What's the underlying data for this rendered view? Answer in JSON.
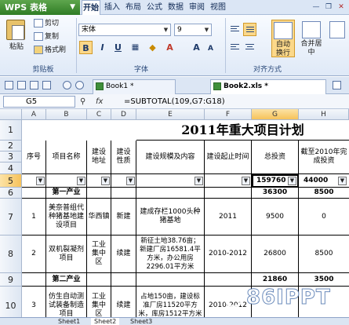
{
  "menubar": {
    "app_title": "WPS 表格",
    "items": [
      "开始",
      "插入",
      "布局",
      "公式",
      "数据",
      "审阅",
      "视图"
    ]
  },
  "ribbon": {
    "paste": "粘贴",
    "cut": "剪切",
    "copy": "复制",
    "format_painter": "格式刷",
    "clipboard_group": "剪贴板",
    "font_name": "宋体",
    "font_size": "9",
    "font_group": "字体",
    "align_group": "对齐方式",
    "wrap_text": "自动\n换行",
    "merge_center": "合并居\n中",
    "bold": "B",
    "italic": "I",
    "underline": "U"
  },
  "tabs": {
    "book1": "Book1 *",
    "book2": "Book2.xls *"
  },
  "formula_bar": {
    "cell_ref": "G5",
    "fx": "fx",
    "formula": "=SUBTOTAL(109,G7:G18)"
  },
  "columns": [
    "A",
    "B",
    "C",
    "D",
    "E",
    "F",
    "G",
    "H"
  ],
  "rows": [
    "1",
    "2",
    "3",
    "4",
    "5",
    "6",
    "7",
    "8",
    "9",
    "10"
  ],
  "sheet": {
    "title": "2011年重大项目计划",
    "headers": {
      "a": "序号",
      "b": "项目名称",
      "c": "建设\n地址",
      "d": "建设\n性质",
      "e": "建设规模及内容",
      "f": "建设起止时间",
      "g": "总投资",
      "h": "截至2010年完成投资"
    },
    "row5": {
      "g": "159760",
      "h": "44000"
    },
    "row6": {
      "b": "第一产业",
      "g": "36300",
      "h": "8500"
    },
    "row7": {
      "a": "1",
      "b": "美奈普组代种猪基地建设项目",
      "c": "华西镇",
      "d": "新建",
      "e": "建成存栏1000头种猪基地",
      "f": "2011",
      "g": "9500",
      "h": "0"
    },
    "row8": {
      "a": "2",
      "b": "双机裂凝剂项目",
      "c": "工业集中区",
      "d": "续建",
      "e": "新征土地38.76亩；新建厂房16581.4平方米，办公用房2296.01平方米",
      "f": "2010-2012",
      "g": "26800",
      "h": "8500"
    },
    "row9": {
      "b": "第二产业",
      "g": "21860",
      "h": "3500"
    },
    "row10": {
      "a": "3",
      "b": "仿生自动测试装备制造项目",
      "c": "工业集中区",
      "d": "续建",
      "e": "占地150亩，建设标准厂房11520平方米，库房1512平方米",
      "f": "2010-2012",
      "g": "",
      "h": ""
    }
  },
  "sheet_tabs": [
    "Sheet1",
    "Sheet2",
    "Sheet3"
  ],
  "watermark": "86IPPT"
}
